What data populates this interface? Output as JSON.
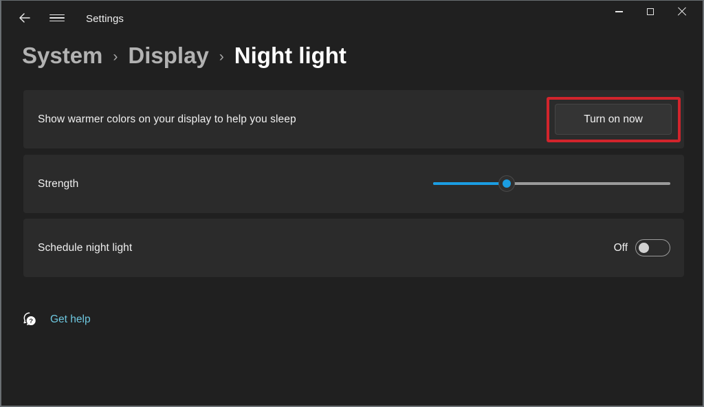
{
  "window": {
    "app_title": "Settings",
    "controls": {
      "minimize_label": "Minimize",
      "maximize_label": "Maximize",
      "close_label": "Close"
    },
    "back_label": "Back",
    "menu_label": "Navigation menu"
  },
  "breadcrumb": {
    "separator": "›",
    "items": [
      {
        "label": "System",
        "current": false
      },
      {
        "label": "Display",
        "current": false
      },
      {
        "label": "Night light",
        "current": true
      }
    ]
  },
  "settings": {
    "night_light_card": {
      "label": "Show warmer colors on your display to help you sleep",
      "button_label": "Turn on now",
      "highlighted": true,
      "highlight_color": "#d2242c"
    },
    "strength_card": {
      "label": "Strength",
      "slider": {
        "value": 31,
        "min": 0,
        "max": 100,
        "fill_color": "#1b9de2",
        "track_color": "#9b9b9b"
      }
    },
    "schedule_card": {
      "label": "Schedule night light",
      "state_label": "Off",
      "toggle_on": false
    }
  },
  "footer": {
    "help_link_label": "Get help",
    "help_icon_name": "help-question-bubble-icon",
    "help_link_color": "#6ec8e0"
  },
  "theme": {
    "page_background": "#202020",
    "card_background": "#2b2b2b",
    "accent": "#1b9de2",
    "text_primary": "#f0f0f0",
    "text_secondary": "#b2b2b2"
  }
}
